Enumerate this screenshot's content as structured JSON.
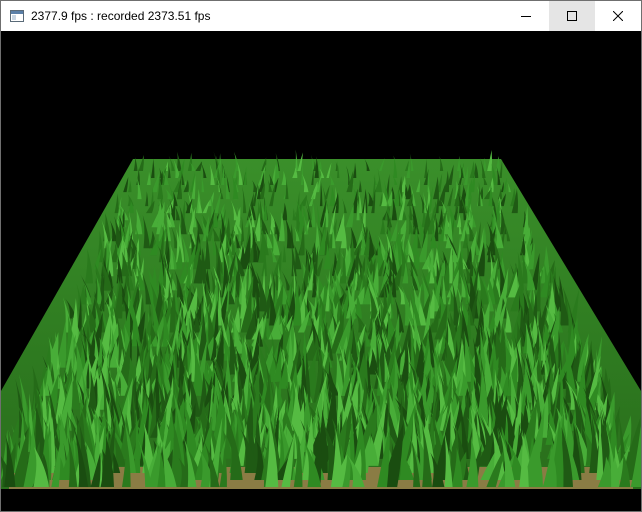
{
  "window": {
    "title": "2377.9 fps : recorded 2373.51 fps",
    "app_icon": "window-icon",
    "controls": [
      {
        "name": "minimize-button",
        "icon": "minimize-icon"
      },
      {
        "name": "maximize-button",
        "icon": "maximize-icon"
      },
      {
        "name": "close-button",
        "icon": "close-icon"
      }
    ]
  },
  "scene": {
    "description_icon": "grass-field-render",
    "background": "#000000",
    "grass_dark": "#1f5a14",
    "grass_mid": "#2f8a22",
    "grass_light": "#4fb43a",
    "soil": "#9a8a4a"
  }
}
